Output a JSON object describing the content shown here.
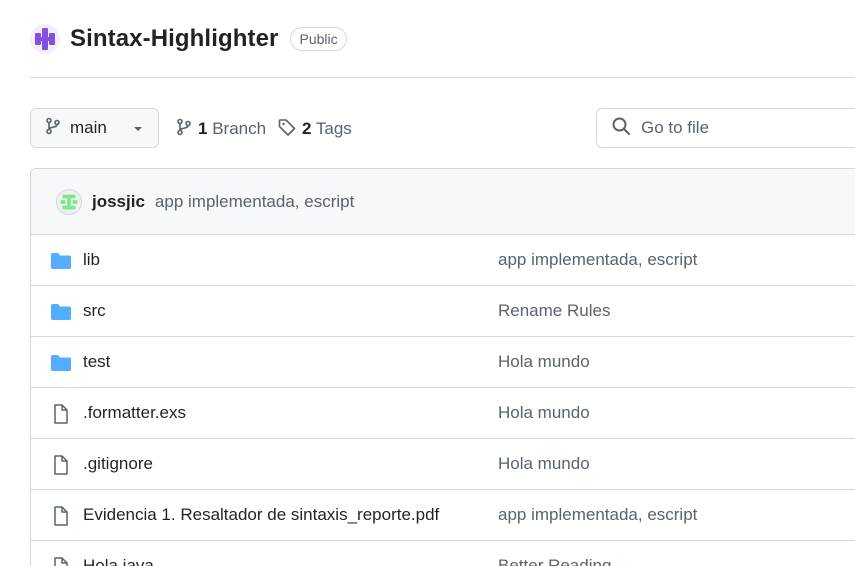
{
  "repo": {
    "name": "Sintax-Highlighter",
    "visibility": "Public"
  },
  "toolbar": {
    "branch": "main",
    "branches_count": "1",
    "branches_label": "Branch",
    "tags_count": "2",
    "tags_label": "Tags",
    "search_placeholder": "Go to file"
  },
  "latest_commit": {
    "author": "jossjic",
    "message": "app implementada, escript"
  },
  "files": [
    {
      "name": "lib",
      "type": "folder",
      "commit": "app implementada, escript"
    },
    {
      "name": "src",
      "type": "folder",
      "commit": "Rename Rules"
    },
    {
      "name": "test",
      "type": "folder",
      "commit": "Hola mundo"
    },
    {
      "name": ".formatter.exs",
      "type": "file",
      "commit": "Hola mundo"
    },
    {
      "name": ".gitignore",
      "type": "file",
      "commit": "Hola mundo"
    },
    {
      "name": "Evidencia 1. Resaltador de sintaxis_reporte.pdf",
      "type": "file",
      "commit": "app implementada, escript"
    },
    {
      "name": "Hola.java",
      "type": "file",
      "commit": "Better Reading"
    }
  ],
  "colors": {
    "folder": "#54aeff",
    "file_icon": "#59636e",
    "avatar_purple": "#8250df",
    "commit_avatar_green": "#7ee787"
  }
}
